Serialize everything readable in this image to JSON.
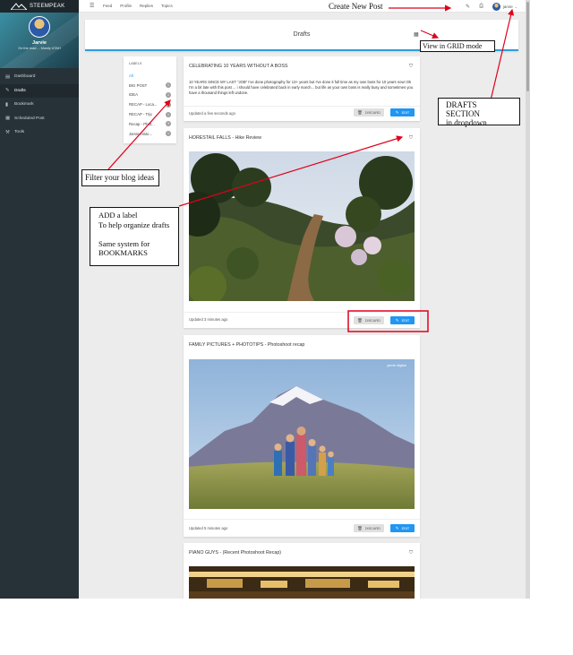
{
  "brand": {
    "name": "STEEMPEAK"
  },
  "profile": {
    "name": "Jarvie",
    "subtitle": "On the road ... Mostly UTAH"
  },
  "sidebar": {
    "items": [
      {
        "label": "Dashboard",
        "icon": "dashboard-icon",
        "glyph": "▤"
      },
      {
        "label": "Drafts",
        "icon": "edit-icon",
        "glyph": "✎"
      },
      {
        "label": "Bookmark",
        "icon": "bookmark-icon",
        "glyph": "▮"
      },
      {
        "label": "Scheduled Post",
        "icon": "calendar-icon",
        "glyph": "▦"
      },
      {
        "label": "Tools",
        "icon": "tools-icon",
        "glyph": "⚒"
      }
    ]
  },
  "topbar": {
    "links": [
      "Feed",
      "Profile",
      "Replies",
      "Topics"
    ],
    "user": "jarvie"
  },
  "drafts": {
    "title": "Drafts"
  },
  "labels": {
    "title": "LABELS",
    "items": [
      {
        "label": "All",
        "count": ""
      },
      {
        "label": "BIG POST",
        "count": "1"
      },
      {
        "label": "IDEA",
        "count": "1"
      },
      {
        "label": "RECAP - Loca...",
        "count": "1"
      },
      {
        "label": "RECAP - Trip",
        "count": "1"
      },
      {
        "label": "Recap - Phot...",
        "count": "3"
      },
      {
        "label": "Jarvie Histo...",
        "count": "1"
      }
    ]
  },
  "cards": [
    {
      "title": "CELEBRATING 10 YEARS WITHOUT A BOSS",
      "excerpt": "10 YEARS SINCE MY LAST \"JOB\" I've done photography for 13+ years but I've done it full time as my own boss for 10 years now! Ok I'm a bit late with this post ... i should have celebrated back in early march... but life as your own boss is really busy and sometimes you have a thousand things left undone.",
      "updated": "Updated a few seconds ago"
    },
    {
      "title": "HORESTAIL FALLS - Hike Review",
      "updated": "Updated 3 minutes ago"
    },
    {
      "title": "FAMILY PICTURES + PHOTOTIPS - Photoshoot recap",
      "updated": "Updated 5 minutes ago",
      "watermark": "jarvie digital"
    },
    {
      "title": "PIANO GUYS - (Recent Photoshoot Recap)"
    }
  ],
  "buttons": {
    "discard": "DISCARD",
    "edit": "EDIT"
  },
  "annotations": {
    "create_post": "Create New Post",
    "grid_mode": "View in GRID mode",
    "drafts_section": [
      "DRAFTS SECTION",
      "in dropdown"
    ],
    "filter": "Filter your blog ideas",
    "label_note": [
      "ADD a label",
      "To help organize drafts",
      "",
      "Same system for",
      "BOOKMARKS"
    ]
  },
  "colors": {
    "sidebar": "#263238",
    "accent": "#2196f3",
    "annotation": "#e0001b"
  }
}
